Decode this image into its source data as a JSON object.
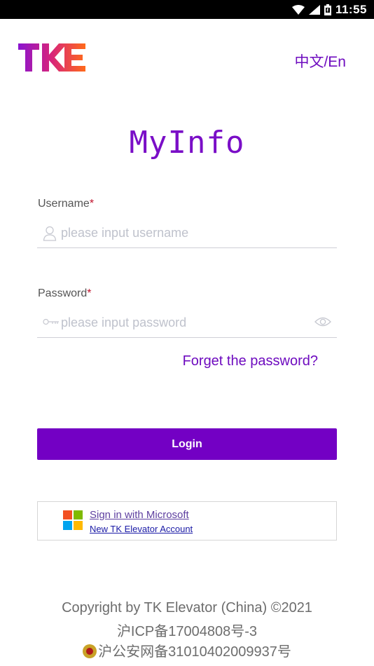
{
  "status_bar": {
    "time": "11:55"
  },
  "header": {
    "brand": "TKE",
    "language_toggle": "中文/En"
  },
  "app_title": "MyInfo",
  "username": {
    "label": "Username",
    "required_mark": "*",
    "placeholder": "please input username",
    "icon": "user-icon"
  },
  "password": {
    "label": "Password",
    "required_mark": "*",
    "placeholder": "please input password",
    "icon": "key-icon",
    "toggle_icon": "eye-icon"
  },
  "forget_link": "Forget the password?",
  "login_button": "Login",
  "microsoft": {
    "sign_in": "Sign in with Microsoft",
    "new_account": "New TK Elevator Account",
    "colors": [
      "#f25022",
      "#7fba00",
      "#00a4ef",
      "#ffb900"
    ]
  },
  "footer": {
    "copyright": "Copyright by TK Elevator (China) ©2021",
    "icp": "沪ICP备17004808号-3",
    "police": "沪公安网备31010402009937号"
  },
  "colors": {
    "accent": "#7300c4",
    "link": "#6e0bbf"
  }
}
